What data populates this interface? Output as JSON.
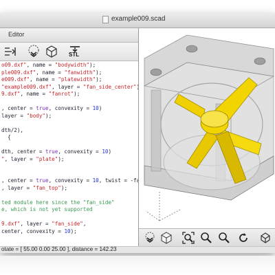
{
  "window": {
    "title": "example009.scad"
  },
  "editor": {
    "panel_title": "Editor",
    "lines": [
      [
        [
          "str",
          "o09.dxf\""
        ],
        [
          "txt",
          ", name = "
        ],
        [
          "str",
          "\"bodywidth\""
        ],
        [
          "txt",
          ");"
        ]
      ],
      [
        [
          "str",
          "ple009.dxf\""
        ],
        [
          "txt",
          ", name = "
        ],
        [
          "str",
          "\"fanwidth\""
        ],
        [
          "txt",
          ");"
        ]
      ],
      [
        [
          "str",
          "e009.dxf\""
        ],
        [
          "txt",
          ", name = "
        ],
        [
          "str",
          "\"platewidth\""
        ],
        [
          "txt",
          ");"
        ]
      ],
      [
        [
          "str",
          "\"example009.dxf\""
        ],
        [
          "txt",
          ", layer = "
        ],
        [
          "str",
          "\"fan_side_center\""
        ],
        [
          "txt",
          ")"
        ]
      ],
      [
        [
          "str",
          "9.dxf\""
        ],
        [
          "txt",
          ", name = "
        ],
        [
          "str",
          "\"fanrot\""
        ],
        [
          "txt",
          ");"
        ]
      ],
      [
        [
          "txt",
          ""
        ]
      ],
      [
        [
          "txt",
          ", center = "
        ],
        [
          "kw",
          "true"
        ],
        [
          "txt",
          ", convexity = "
        ],
        [
          "num",
          "10"
        ],
        [
          "txt",
          ")"
        ]
      ],
      [
        [
          "txt",
          "layer = "
        ],
        [
          "str",
          "\"body\""
        ],
        [
          "txt",
          ");"
        ]
      ],
      [
        [
          "txt",
          ""
        ]
      ],
      [
        [
          "txt",
          "dth/2),"
        ]
      ],
      [
        [
          "txt",
          "  {"
        ]
      ],
      [
        [
          "txt",
          ""
        ]
      ],
      [
        [
          "txt",
          "dth, center = "
        ],
        [
          "kw",
          "true"
        ],
        [
          "txt",
          ", convexity = "
        ],
        [
          "num",
          "10"
        ],
        [
          "txt",
          ")"
        ]
      ],
      [
        [
          "str",
          "\""
        ],
        [
          "txt",
          ", layer = "
        ],
        [
          "str",
          "\"plate\""
        ],
        [
          "txt",
          ");"
        ]
      ],
      [
        [
          "txt",
          ""
        ]
      ],
      [
        [
          "txt",
          ""
        ]
      ],
      [
        [
          "txt",
          ", center = "
        ],
        [
          "kw",
          "true"
        ],
        [
          "txt",
          ", convexity = "
        ],
        [
          "num",
          "10"
        ],
        [
          "txt",
          ", twist = -fanrot)"
        ]
      ],
      [
        [
          "txt",
          ", layer = "
        ],
        [
          "str",
          "\"fan_top\""
        ],
        [
          "txt",
          ");"
        ]
      ],
      [
        [
          "txt",
          ""
        ]
      ],
      [
        [
          "cmt",
          "ted module here since the \"fan_side\""
        ]
      ],
      [
        [
          "cmt",
          "e, which is not yet supported"
        ]
      ],
      [
        [
          "txt",
          ""
        ]
      ],
      [
        [
          "str",
          "9.dxf\""
        ],
        [
          "txt",
          ", layer = "
        ],
        [
          "str",
          "\"fan_side\""
        ],
        [
          "txt",
          ","
        ]
      ],
      [
        [
          "txt",
          "center, convexity = "
        ],
        [
          "num",
          "10"
        ],
        [
          "txt",
          ");"
        ]
      ]
    ]
  },
  "editor_toolbar": {
    "buttons": [
      {
        "name": "indent-icon"
      },
      {
        "name": "render-preview-icon"
      },
      {
        "name": "render-cgal-icon"
      },
      {
        "name": "export-stl-icon",
        "label": "STL"
      }
    ]
  },
  "viewer_toolbar": {
    "buttons": [
      {
        "name": "preview-icon"
      },
      {
        "name": "render-icon"
      },
      {
        "name": "view-all-icon"
      },
      {
        "name": "zoom-in-icon"
      },
      {
        "name": "zoom-out-icon"
      },
      {
        "name": "reset-view-icon"
      },
      {
        "name": "perspective-icon"
      }
    ]
  },
  "status": {
    "text": "otate = [ 55.00 0.00 25.00 ], distance = 142.23"
  },
  "colors": {
    "model_gray": "#c9c9c9",
    "model_yellow": "#f2d400"
  }
}
